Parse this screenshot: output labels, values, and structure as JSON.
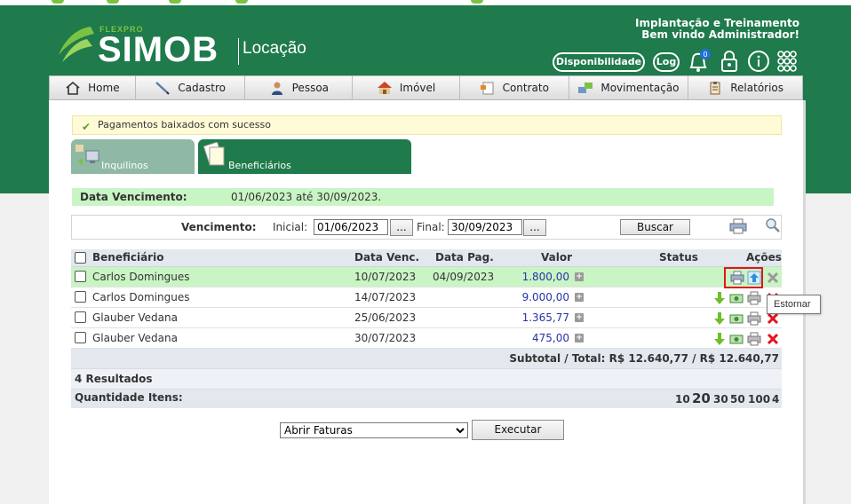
{
  "app": {
    "brand_small": "FLEXPRO",
    "brand": "SIMOB",
    "module": "Locação",
    "welcome_line1": "Implantação e Treinamento",
    "welcome_line2": "Bem vindo Administrador!",
    "disponibilidade_label": "Disponibilidade",
    "log_label": "Log",
    "notification_count": "0",
    "colors": {
      "header_green": "#1f7a4c",
      "accent_green": "#7cc242",
      "highlight": "#c9f5c4",
      "danger": "#e0161e"
    }
  },
  "nav": [
    {
      "label": "Home",
      "icon": "home-icon"
    },
    {
      "label": "Cadastro",
      "icon": "pencil-icon"
    },
    {
      "label": "Pessoa",
      "icon": "person-icon"
    },
    {
      "label": "Imóvel",
      "icon": "house-icon"
    },
    {
      "label": "Contrato",
      "icon": "contract-icon"
    },
    {
      "label": "Movimentação",
      "icon": "transfer-icon"
    },
    {
      "label": "Relatórios",
      "icon": "clipboard-icon"
    }
  ],
  "message": "Pagamentos baixados com sucesso",
  "tabs": [
    {
      "label": "Inquilinos",
      "icon": "tenants-icon"
    },
    {
      "label": "Beneficiários",
      "icon": "documents-icon"
    }
  ],
  "vencimento_bar": {
    "label": "Data Vencimento:",
    "value": "01/06/2023 até 30/09/2023."
  },
  "filter": {
    "label": "Vencimento:",
    "inicial_label": "Inicial:",
    "inicial_value": "01/06/2023",
    "final_label": "Final:",
    "final_value": "30/09/2023",
    "ellipsis": "...",
    "buscar": "Buscar"
  },
  "table": {
    "headers": {
      "beneficiario": "Beneficiário",
      "data_venc": "Data Venc.",
      "data_pag": "Data Pag.",
      "valor": "Valor",
      "status": "Status",
      "acoes": "Ações"
    },
    "rows": [
      {
        "beneficiario": "Carlos Domingues",
        "data_venc": "10/07/2023",
        "data_pag": "04/09/2023",
        "valor": "1.800,00",
        "status": "",
        "paid": true
      },
      {
        "beneficiario": "Carlos Domingues",
        "data_venc": "14/07/2023",
        "data_pag": "",
        "valor": "9.000,00",
        "status": "",
        "paid": false
      },
      {
        "beneficiario": "Glauber Vedana",
        "data_venc": "25/06/2023",
        "data_pag": "",
        "valor": "1.365,77",
        "status": "",
        "paid": false
      },
      {
        "beneficiario": "Glauber Vedana",
        "data_venc": "30/07/2023",
        "data_pag": "",
        "valor": "475,00",
        "status": "",
        "paid": false
      }
    ],
    "subtotal": "Subtotal / Total: R$ 12.640,77 / R$ 12.640,77",
    "results": "4 Resultados",
    "quantidade_label": "Quantidade Itens:",
    "page_sizes": [
      "10",
      "20",
      "30",
      "50",
      "100",
      "4"
    ],
    "selected_page_size": "20"
  },
  "tooltip": "Estornar",
  "bottom": {
    "action_selected": "Abrir Faturas",
    "executar": "Executar"
  }
}
